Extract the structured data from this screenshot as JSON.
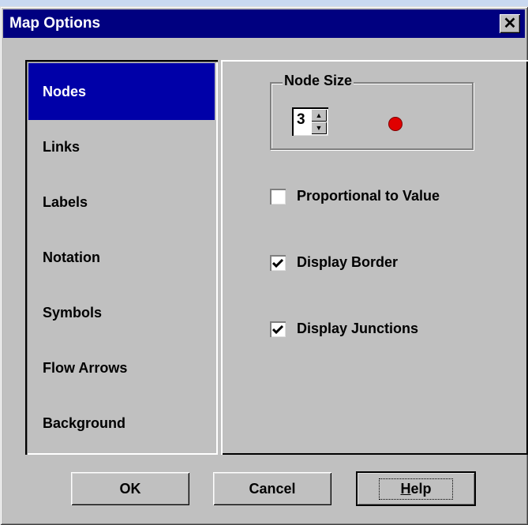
{
  "window": {
    "title": "Map Options",
    "close_glyph": "✕"
  },
  "sidebar": {
    "items": [
      {
        "label": "Nodes",
        "active": true
      },
      {
        "label": "Links"
      },
      {
        "label": "Labels"
      },
      {
        "label": "Notation"
      },
      {
        "label": "Symbols"
      },
      {
        "label": "Flow Arrows"
      },
      {
        "label": "Background"
      }
    ]
  },
  "panel": {
    "node_size": {
      "legend": "Node Size",
      "value": "3",
      "swatch_color": "#e00000"
    },
    "checkboxes": [
      {
        "label": "Proportional to Value",
        "checked": false
      },
      {
        "label": "Display Border",
        "checked": true
      },
      {
        "label": "Display Junctions",
        "checked": true
      }
    ]
  },
  "buttons": {
    "ok": "OK",
    "cancel": "Cancel",
    "help_prefix": "H",
    "help_rest": "elp"
  },
  "colors": {
    "titlebar": "#000080",
    "selection": "#0000a8",
    "face": "#c0c0c0"
  }
}
